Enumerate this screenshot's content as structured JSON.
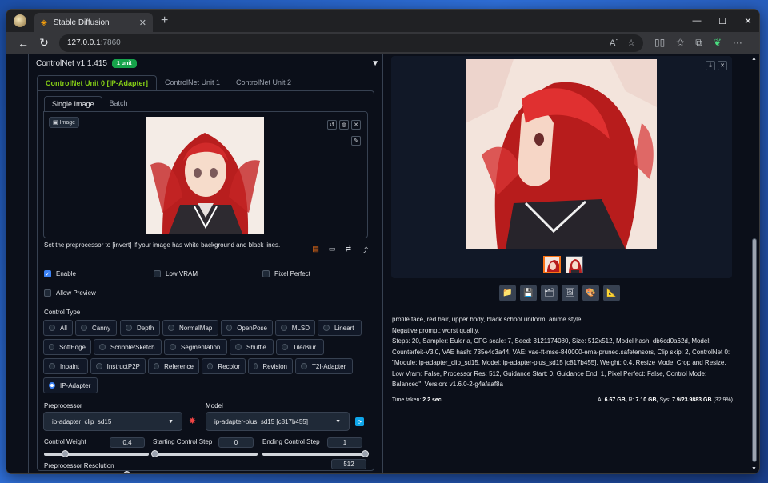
{
  "browser": {
    "tab_title": "Stable Diffusion",
    "url_host": "127.0.0.1",
    "url_port": ":7860"
  },
  "controlnet": {
    "title": "ControlNet v1.1.415",
    "badge": "1 unit",
    "unit_tabs": [
      "ControlNet Unit 0 [IP-Adapter]",
      "ControlNet Unit 1",
      "ControlNet Unit 2"
    ],
    "image_tabs": [
      "Single Image",
      "Batch"
    ],
    "image_label": "Image",
    "hint": "Set the preprocessor to [invert] If your image has white background and black lines.",
    "checks": {
      "enable": "Enable",
      "low_vram": "Low VRAM",
      "pixel_perfect": "Pixel Perfect",
      "allow_preview": "Allow Preview"
    },
    "control_type_label": "Control Type",
    "control_types": [
      "All",
      "Canny",
      "Depth",
      "NormalMap",
      "OpenPose",
      "MLSD",
      "Lineart",
      "SoftEdge",
      "Scribble/Sketch",
      "Segmentation",
      "Shuffle",
      "Tile/Blur",
      "Inpaint",
      "InstructP2P",
      "Reference",
      "Recolor",
      "Revision",
      "T2I-Adapter",
      "IP-Adapter"
    ],
    "selected_control_type": "IP-Adapter",
    "preprocessor_label": "Preprocessor",
    "preprocessor_value": "ip-adapter_clip_sd15",
    "model_label": "Model",
    "model_value": "ip-adapter-plus_sd15 [c817b455]",
    "control_weight_label": "Control Weight",
    "control_weight": "0.4",
    "control_weight_fraction": 0.2,
    "start_step_label": "Starting Control Step",
    "start_step": "0",
    "end_step_label": "Ending Control Step",
    "end_step": "1",
    "preproc_res_label": "Preprocessor Resolution",
    "preproc_res": "512",
    "preproc_res_fraction": 0.24
  },
  "output": {
    "prompt": "profile face, red hair, upper body, black school uniform, anime style",
    "negative": "Negative prompt: worst quality,",
    "params": "Steps: 20, Sampler: Euler a, CFG scale: 7, Seed: 3121174080, Size: 512x512, Model hash: db6cd0a62d, Model: Counterfeit-V3.0, VAE hash: 735e4c3a44, VAE: vae-ft-mse-840000-ema-pruned.safetensors, Clip skip: 2, ControlNet 0: \"Module: ip-adapter_clip_sd15, Model: ip-adapter-plus_sd15 [c817b455], Weight: 0.4, Resize Mode: Crop and Resize, Low Vram: False, Processor Res: 512, Guidance Start: 0, Guidance End: 1, Pixel Perfect: False, Control Mode: Balanced\", Version: v1.6.0-2-g4afaaf8a",
    "time_label": "Time taken:",
    "time_value": "2.2 sec.",
    "mem_a_label": "A:",
    "mem_a": "6.67 GB,",
    "mem_r_label": "R:",
    "mem_r": "7.10 GB,",
    "mem_sys_label": "Sys:",
    "mem_sys": "7.9/23.9883 GB",
    "mem_pct": "(32.9%)"
  }
}
